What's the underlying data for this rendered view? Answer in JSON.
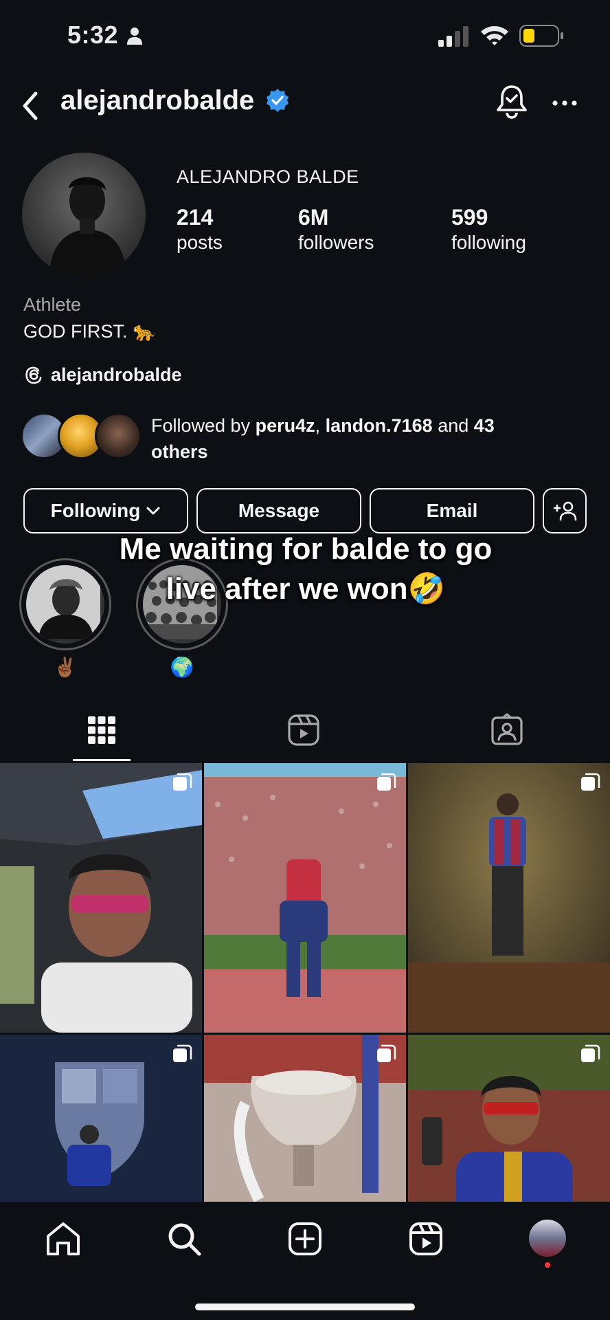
{
  "status_bar": {
    "time": "5:32",
    "icons": [
      "person-icon",
      "signal-icon",
      "wifi-icon",
      "battery-icon"
    ],
    "battery_color": "#ffd60a"
  },
  "header": {
    "username": "alejandrobalde",
    "verified_color": "#3897f0",
    "icons": [
      "back-icon",
      "verified-icon",
      "notification-bell-icon",
      "more-icon"
    ]
  },
  "profile": {
    "full_name": "ALEJANDRO BALDE",
    "stats": [
      {
        "value": "214",
        "label": "posts"
      },
      {
        "value": "6M",
        "label": "followers"
      },
      {
        "value": "599",
        "label": "following"
      }
    ],
    "category": "Athlete",
    "bio": "GOD FIRST. 🐆",
    "threads_handle": "alejandrobalde"
  },
  "followed_by": {
    "prefix": "Followed by ",
    "user1": "peru4z",
    "separator": ", ",
    "user2": "landon.7168",
    "and_text": " and ",
    "count": "43",
    "suffix": "others"
  },
  "actions": {
    "following": "Following",
    "message": "Message",
    "email": "Email"
  },
  "highlights": [
    {
      "label": "✌🏾"
    },
    {
      "label": "🌍"
    }
  ],
  "overlay_caption": {
    "line1": "Me waiting for balde to go",
    "line2": "live after we won🤣"
  },
  "tabs": [
    "posts-grid-tab",
    "reels-tab",
    "tagged-tab"
  ],
  "bottom_nav": [
    "home",
    "search",
    "create",
    "reels",
    "profile"
  ],
  "colors": {
    "background": "#0c1014",
    "text": "#f5f5f5",
    "secondary_text": "#a8a8a8",
    "notification_dot": "#ff3040"
  }
}
